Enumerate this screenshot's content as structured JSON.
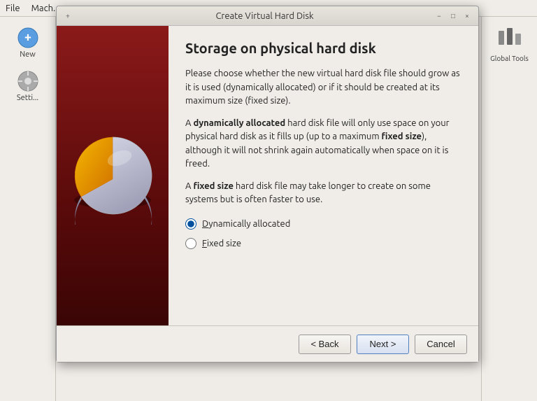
{
  "app": {
    "title": "Create Virtual Hard Disk",
    "menubar": {
      "items": [
        {
          "label": "File"
        },
        {
          "label": "Mach..."
        }
      ]
    },
    "toolbar": {
      "new_label": "New",
      "settings_label": "Setti..."
    },
    "right_panel": {
      "tools_label": "Global Tools"
    }
  },
  "dialog": {
    "title": "Create Virtual Hard Disk",
    "titlebar_controls": [
      "+",
      "−",
      "×"
    ],
    "content": {
      "heading": "Storage on physical hard disk",
      "paragraph1": "Please choose whether the new virtual hard disk file should grow as it is used (dynamically allocated) or if it should be created at its maximum size (fixed size).",
      "paragraph2_prefix": "A ",
      "paragraph2_bold1": "dynamically allocated",
      "paragraph2_middle": " hard disk file will only use space on your physical hard disk as it fills up (up to a maximum ",
      "paragraph2_bold2": "fixed size",
      "paragraph2_suffix": "), although it will not shrink again automatically when space on it is freed.",
      "paragraph3_prefix": "A ",
      "paragraph3_bold": "fixed size",
      "paragraph3_suffix": " hard disk file may take longer to create on some systems but is often faster to use.",
      "options": [
        {
          "id": "dynamic",
          "label": "Dynamically allocated",
          "checked": true
        },
        {
          "id": "fixed",
          "label": "Fixed size",
          "checked": false
        }
      ]
    },
    "footer": {
      "back_label": "< Back",
      "next_label": "Next >",
      "cancel_label": "Cancel"
    }
  }
}
